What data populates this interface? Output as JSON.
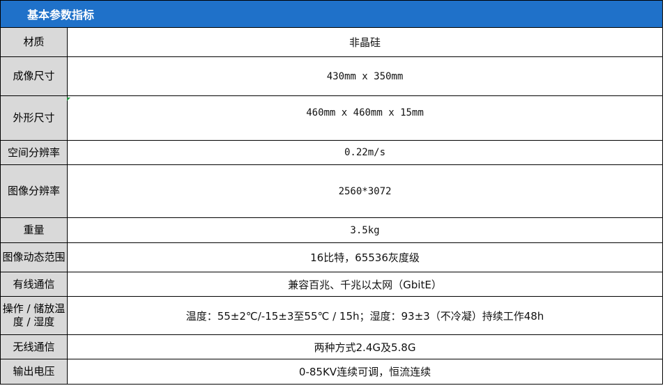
{
  "header": {
    "title": "基本参数指标"
  },
  "rows": [
    {
      "label": "材质",
      "value": "非晶硅"
    },
    {
      "label": "成像尺寸",
      "value": "430mm x 350mm"
    },
    {
      "label": "外形尺寸",
      "value": "460mm x 460mm x 15mm"
    },
    {
      "label": "空间分辨率",
      "value": "0.22m/s"
    },
    {
      "label": "图像分辨率",
      "value": "2560*3072"
    },
    {
      "label": "重量",
      "value": "3.5kg"
    },
    {
      "label": "图像动态范围",
      "value": "16比特，65536灰度级"
    },
    {
      "label": "有线通信",
      "value": "兼容百兆、千兆以太网（GbitE）"
    },
    {
      "label": "操作 / 储放温度 / 湿度",
      "value": "温度：55±2℃/-15±3至55℃ / 15h；湿度：93±3（不冷凝）持续工作48h"
    },
    {
      "label": "无线通信",
      "value": "两种方式2.4G及5.8G"
    },
    {
      "label": "输出电压",
      "value": "0-85KV连续可调，恒流连续"
    }
  ],
  "colors": {
    "header_bg": "#1f71c9",
    "label_bg": "#d9d9d9"
  }
}
